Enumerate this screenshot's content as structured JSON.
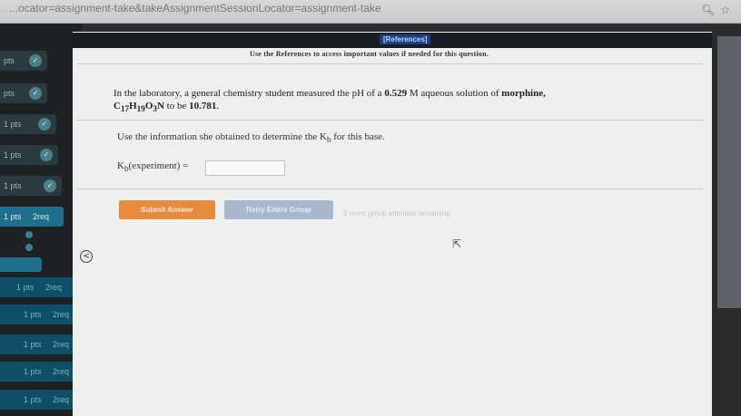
{
  "browser": {
    "url_text": "...ocator=assignment-take&takeAssignmentSessionLocator=assignment-take",
    "icons": [
      "search-icon",
      "star-icon"
    ]
  },
  "sidebar": {
    "items": [
      {
        "label": "pts",
        "badge": "",
        "tag": ""
      },
      {
        "label": "pts",
        "badge": "",
        "tag": ""
      },
      {
        "label": "1 pts",
        "badge": "",
        "tag": ""
      },
      {
        "label": "1 pts",
        "badge": "",
        "tag": ""
      },
      {
        "label": "1 pts",
        "badge": "",
        "tag": ""
      },
      {
        "label": "1 pts",
        "badge": "",
        "tag": "2req"
      },
      {
        "label": "1 pts",
        "badge": "",
        "tag": "2req"
      },
      {
        "label": "1 pts",
        "badge": "",
        "tag": "2req"
      },
      {
        "label": "1 pts",
        "badge": "",
        "tag": "2req"
      },
      {
        "label": "1 pts",
        "badge": "",
        "tag": "2req"
      },
      {
        "label": "1 pts",
        "badge": "",
        "tag": "2req"
      }
    ],
    "collapse_icon": "chevron-left-icon",
    "collapse_glyph": "<"
  },
  "references": {
    "tab_label": "[References]",
    "note": "Use the References to access important values if needed for this question."
  },
  "question": {
    "line1_pre": "In the laboratory, a general chemistry student measured the pH of a ",
    "concentration": "0.529",
    "line1_mid": " M aqueous solution of ",
    "compound": "morphine",
    "line1_end": ",",
    "formula": "C17H19O3N",
    "line2_mid": " to be ",
    "ph_value": "10.781",
    "line2_end": ".",
    "info_text": "Use the information she obtained to determine the Kb for this base.",
    "answer_label": "Kb(experiment) =",
    "answer_value": ""
  },
  "actions": {
    "submit_label": "Submit Answer",
    "retry_label": "Retry Entire Group",
    "attempts_text": "9 more group attempts remaining"
  },
  "colors": {
    "submit": "#e68a3e",
    "retry": "#a9b8cf",
    "references_tab": "#1a3f85",
    "sidebar_active": "#1f6e8c"
  }
}
